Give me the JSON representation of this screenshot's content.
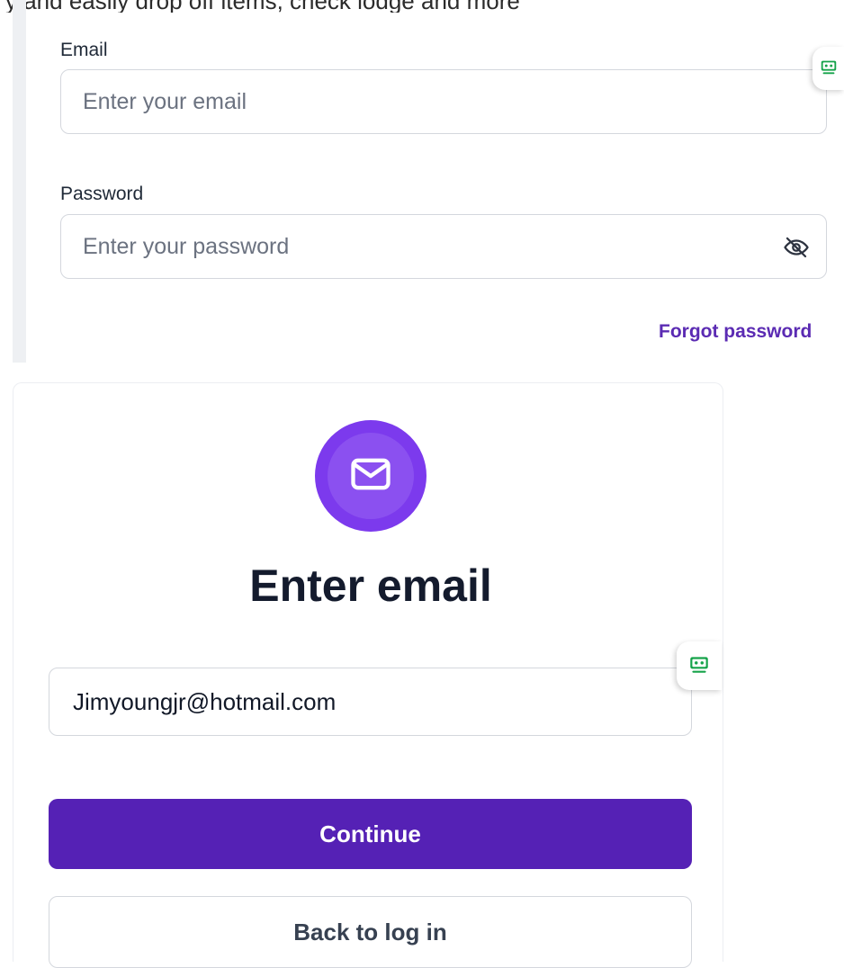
{
  "top_cutoff_text": "y and easily drop off items, check lodge and more",
  "login_form": {
    "email_label": "Email",
    "email_placeholder": "Enter your email",
    "email_value": "",
    "password_label": "Password",
    "password_placeholder": "Enter your password",
    "password_value": "",
    "password_toggle_icon": "eye-off-icon",
    "forgot_password_label": "Forgot password"
  },
  "extension_tab_icon": "robot-icon",
  "modal": {
    "icon": "envelope-icon",
    "title": "Enter email",
    "email_value": "Jimyoungjr@hotmail.com",
    "continue_label": "Continue",
    "back_label": "Back to log in"
  },
  "colors": {
    "primary": "#5521b5",
    "accent_violet": "#7c3aed",
    "link": "#5b2bb3",
    "extension_green": "#16a34a"
  }
}
